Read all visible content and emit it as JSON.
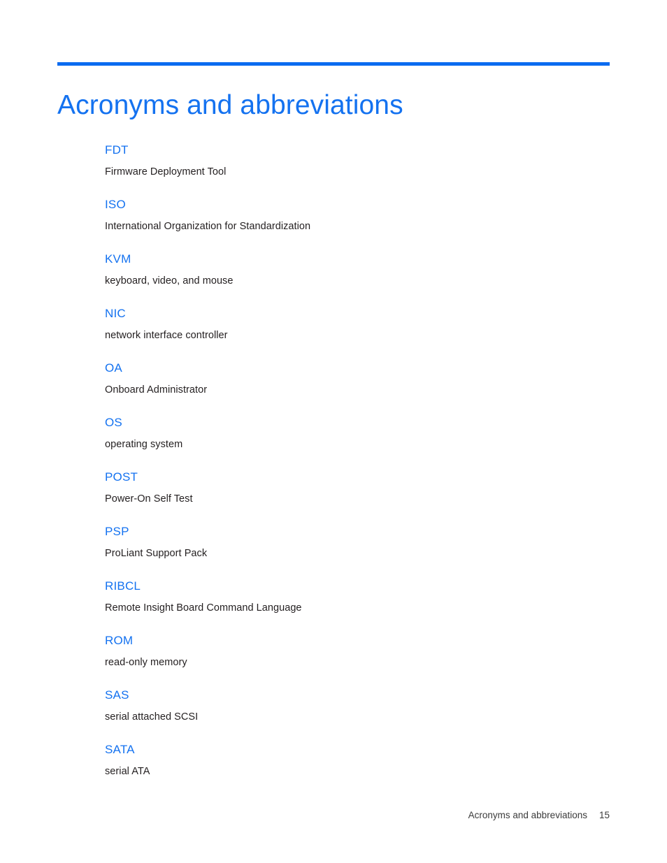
{
  "document": {
    "title": "Acronyms and abbreviations",
    "accent_color": "#1472f0",
    "rule_color": "#0b6bf0",
    "body_text_color": "#231f20"
  },
  "glossary": {
    "entries": [
      {
        "term": "FDT",
        "definition": "Firmware Deployment Tool"
      },
      {
        "term": "ISO",
        "definition": "International Organization for Standardization"
      },
      {
        "term": "KVM",
        "definition": "keyboard, video, and mouse"
      },
      {
        "term": "NIC",
        "definition": "network interface controller"
      },
      {
        "term": "OA",
        "definition": "Onboard Administrator"
      },
      {
        "term": "OS",
        "definition": "operating system"
      },
      {
        "term": "POST",
        "definition": "Power-On Self Test"
      },
      {
        "term": "PSP",
        "definition": "ProLiant Support Pack"
      },
      {
        "term": "RIBCL",
        "definition": "Remote Insight Board Command Language"
      },
      {
        "term": "ROM",
        "definition": "read-only memory"
      },
      {
        "term": "SAS",
        "definition": "serial attached SCSI"
      },
      {
        "term": "SATA",
        "definition": "serial ATA"
      }
    ]
  },
  "footer": {
    "label": "Acronyms and abbreviations",
    "page_number": "15"
  }
}
